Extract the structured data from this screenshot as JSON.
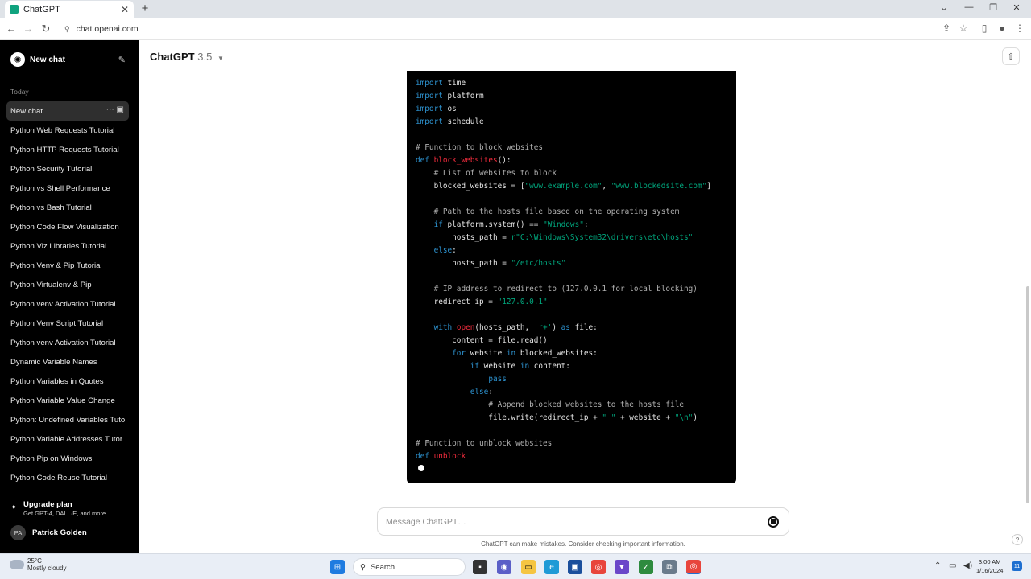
{
  "browser": {
    "tab_title": "ChatGPT",
    "url": "chat.openai.com",
    "icons": [
      "back-icon",
      "forward-icon",
      "reload-icon",
      "site-info-icon",
      "share-page-icon",
      "bookmark-star-icon",
      "side-panel-icon",
      "profile-icon",
      "menu-icon"
    ]
  },
  "sidebar": {
    "new_chat_label": "New chat",
    "section_today": "Today",
    "history": [
      "New chat",
      "Python Web Requests Tutorial",
      "Python HTTP Requests Tutorial",
      "Python Security Tutorial",
      "Python vs Shell Performance",
      "Python vs Bash Tutorial",
      "Python Code Flow Visualization",
      "Python Viz Libraries Tutorial",
      "Python Venv & Pip Tutorial",
      "Python Virtualenv & Pip",
      "Python venv Activation Tutorial",
      "Python Venv Script Tutorial",
      "Python venv Activation Tutorial",
      "Dynamic Variable Names",
      "Python Variables in Quotes",
      "Python Variable Value Change",
      "Python: Undefined Variables Tuto",
      "Python Variable Addresses Tutor",
      "Python Pip on Windows",
      "Python Code Reuse Tutorial"
    ],
    "upgrade_title": "Upgrade plan",
    "upgrade_sub": "Get GPT-4, DALL·E, and more",
    "user_initials": "PA",
    "user_name": "Patrick Golden"
  },
  "header": {
    "model_name": "ChatGPT",
    "model_version": "3.5"
  },
  "code_lines": [
    [
      [
        "kw",
        "import"
      ],
      [
        "p",
        " time"
      ]
    ],
    [
      [
        "kw",
        "import"
      ],
      [
        "p",
        " platform"
      ]
    ],
    [
      [
        "kw",
        "import"
      ],
      [
        "p",
        " os"
      ]
    ],
    [
      [
        "kw",
        "import"
      ],
      [
        "p",
        " schedule"
      ]
    ],
    [],
    [
      [
        "cm",
        "# Function to block websites"
      ]
    ],
    [
      [
        "kw",
        "def"
      ],
      [
        "p",
        " "
      ],
      [
        "fn",
        "block_websites"
      ],
      [
        "p",
        "():"
      ]
    ],
    [
      [
        "p",
        "    "
      ],
      [
        "cm",
        "# List of websites to block"
      ]
    ],
    [
      [
        "p",
        "    blocked_websites = ["
      ],
      [
        "str",
        "\"www.example.com\""
      ],
      [
        "p",
        ", "
      ],
      [
        "str",
        "\"www.blockedsite.com\""
      ],
      [
        "p",
        "]"
      ]
    ],
    [],
    [
      [
        "p",
        "    "
      ],
      [
        "cm",
        "# Path to the hosts file based on the operating system"
      ]
    ],
    [
      [
        "p",
        "    "
      ],
      [
        "kw",
        "if"
      ],
      [
        "p",
        " platform.system() == "
      ],
      [
        "str",
        "\"Windows\""
      ],
      [
        "p",
        ":"
      ]
    ],
    [
      [
        "p",
        "        hosts_path = "
      ],
      [
        "str",
        "r\"C:\\Windows\\System32\\drivers\\etc\\hosts\""
      ]
    ],
    [
      [
        "p",
        "    "
      ],
      [
        "kw",
        "else"
      ],
      [
        "p",
        ":"
      ]
    ],
    [
      [
        "p",
        "        hosts_path = "
      ],
      [
        "str",
        "\"/etc/hosts\""
      ]
    ],
    [],
    [
      [
        "p",
        "    "
      ],
      [
        "cm",
        "# IP address to redirect to (127.0.0.1 for local blocking)"
      ]
    ],
    [
      [
        "p",
        "    redirect_ip = "
      ],
      [
        "str",
        "\"127.0.0.1\""
      ]
    ],
    [],
    [
      [
        "p",
        "    "
      ],
      [
        "kw",
        "with"
      ],
      [
        "p",
        " "
      ],
      [
        "fn",
        "open"
      ],
      [
        "p",
        "(hosts_path, "
      ],
      [
        "str",
        "'r+'"
      ],
      [
        "p",
        ") "
      ],
      [
        "kw",
        "as"
      ],
      [
        "p",
        " file:"
      ]
    ],
    [
      [
        "p",
        "        content = file.read()"
      ]
    ],
    [
      [
        "p",
        "        "
      ],
      [
        "kw",
        "for"
      ],
      [
        "p",
        " website "
      ],
      [
        "kw",
        "in"
      ],
      [
        "p",
        " blocked_websites:"
      ]
    ],
    [
      [
        "p",
        "            "
      ],
      [
        "kw",
        "if"
      ],
      [
        "p",
        " website "
      ],
      [
        "kw",
        "in"
      ],
      [
        "p",
        " content:"
      ]
    ],
    [
      [
        "p",
        "                "
      ],
      [
        "kw",
        "pass"
      ]
    ],
    [
      [
        "p",
        "            "
      ],
      [
        "kw",
        "else"
      ],
      [
        "p",
        ":"
      ]
    ],
    [
      [
        "p",
        "                "
      ],
      [
        "cm",
        "# Append blocked websites to the hosts file"
      ]
    ],
    [
      [
        "p",
        "                file.write(redirect_ip + "
      ],
      [
        "str",
        "\" \""
      ],
      [
        "p",
        " + website + "
      ],
      [
        "str",
        "\"\\n\""
      ],
      [
        "p",
        ")"
      ]
    ],
    [],
    [
      [
        "cm",
        "# Function to unblock websites"
      ]
    ],
    [
      [
        "kw",
        "def"
      ],
      [
        "p",
        " "
      ],
      [
        "fn",
        "unblock"
      ]
    ]
  ],
  "composer": {
    "placeholder": "Message ChatGPT…",
    "disclaimer": "ChatGPT can make mistakes. Consider checking important information."
  },
  "taskbar": {
    "temperature": "25°C",
    "weather": "Mostly cloudy",
    "search_label": "Search",
    "time": "3:00 AM",
    "date": "1/16/2024",
    "notifications": "11"
  }
}
